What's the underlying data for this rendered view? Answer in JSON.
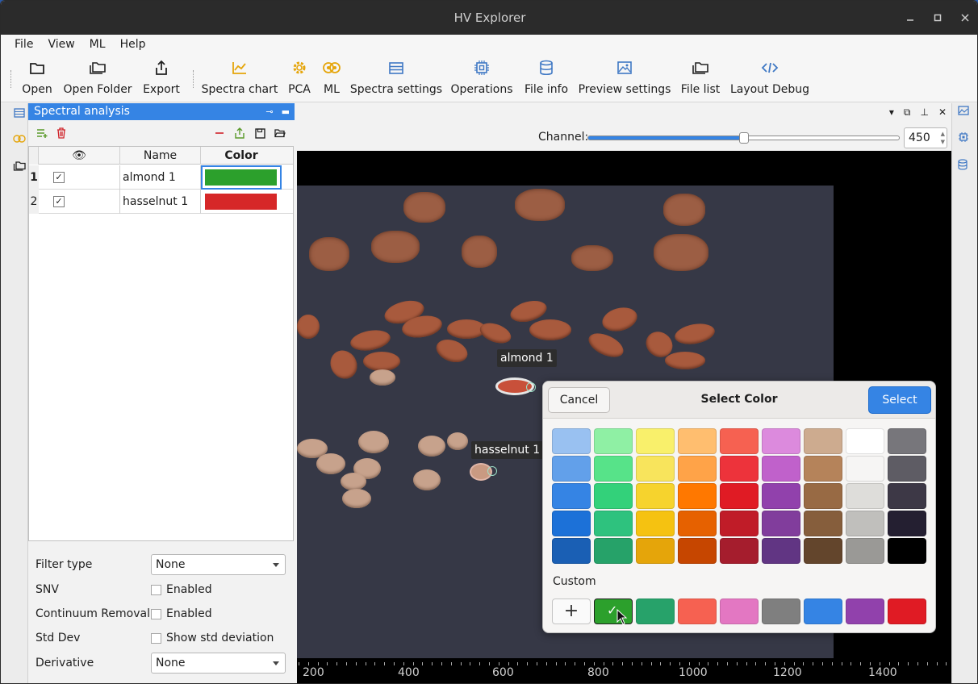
{
  "window": {
    "title": "HV Explorer"
  },
  "menu": [
    "File",
    "View",
    "ML",
    "Help"
  ],
  "toolbar": {
    "open": "Open",
    "open_folder": "Open Folder",
    "export": "Export",
    "spectra_chart": "Spectra chart",
    "pca": "PCA",
    "ml": "ML",
    "spectra_settings": "Spectra settings",
    "operations": "Operations",
    "file_info": "File info",
    "preview_settings": "Preview settings",
    "file_list": "File list",
    "layout_debug": "Layout Debug"
  },
  "panel": {
    "title": "Spectral analysis",
    "table": {
      "headers": {
        "visible": "👁",
        "name": "Name",
        "color": "Color"
      },
      "rows": [
        {
          "num": "1",
          "checked": "✓",
          "name": "almond 1",
          "color": "#2ca02c"
        },
        {
          "num": "2",
          "checked": "✓",
          "name": "hasselnut 1",
          "color": "#d62728"
        }
      ]
    },
    "form": {
      "filter_type_label": "Filter type",
      "filter_type_value": "None",
      "snv_label": "SNV",
      "snv_value": "Enabled",
      "cr_label": "Continuum Removal",
      "cr_value": "Enabled",
      "std_label": "Std Dev",
      "std_value": "Show std deviation",
      "deriv_label": "Derivative",
      "deriv_value": "None"
    }
  },
  "viewer": {
    "channel_label": "Channel:",
    "channel_value": "450",
    "channel_fraction": 0.5,
    "roi_labels": {
      "almond": "almond 1",
      "hazelnut": "hasselnut 1"
    },
    "axis_ticks": [
      "200",
      "400",
      "600",
      "800",
      "1000",
      "1200",
      "1400"
    ]
  },
  "dialog": {
    "cancel": "Cancel",
    "title": "Select Color",
    "select": "Select",
    "custom_label": "Custom",
    "plus": "+",
    "palette": [
      [
        "#99c1f1",
        "#8ff0a4",
        "#f9f06b",
        "#ffbe6f",
        "#f66151",
        "#dc8add",
        "#cdab8f",
        "#ffffff",
        "#77767b"
      ],
      [
        "#62a0ea",
        "#57e389",
        "#f8e45c",
        "#ffa348",
        "#ed333b",
        "#c061cb",
        "#b5835a",
        "#f6f5f4",
        "#5e5c64"
      ],
      [
        "#3584e4",
        "#33d17a",
        "#f6d32d",
        "#ff7800",
        "#e01b24",
        "#9141ac",
        "#986a44",
        "#deddda",
        "#3d3846"
      ],
      [
        "#1c71d8",
        "#2ec27e",
        "#f5c211",
        "#e66100",
        "#c01c28",
        "#813d9c",
        "#865e3c",
        "#c0bfbc",
        "#241f31"
      ],
      [
        "#1a5fb4",
        "#26a269",
        "#e5a50a",
        "#c64600",
        "#a51d2d",
        "#613583",
        "#63452c",
        "#9a9996",
        "#000000"
      ]
    ],
    "custom": [
      "#2ca02c",
      "#27a26a",
      "#f66151",
      "#e377c2",
      "#7f7f7f",
      "#3584e4",
      "#9141ac",
      "#e01b24"
    ]
  }
}
